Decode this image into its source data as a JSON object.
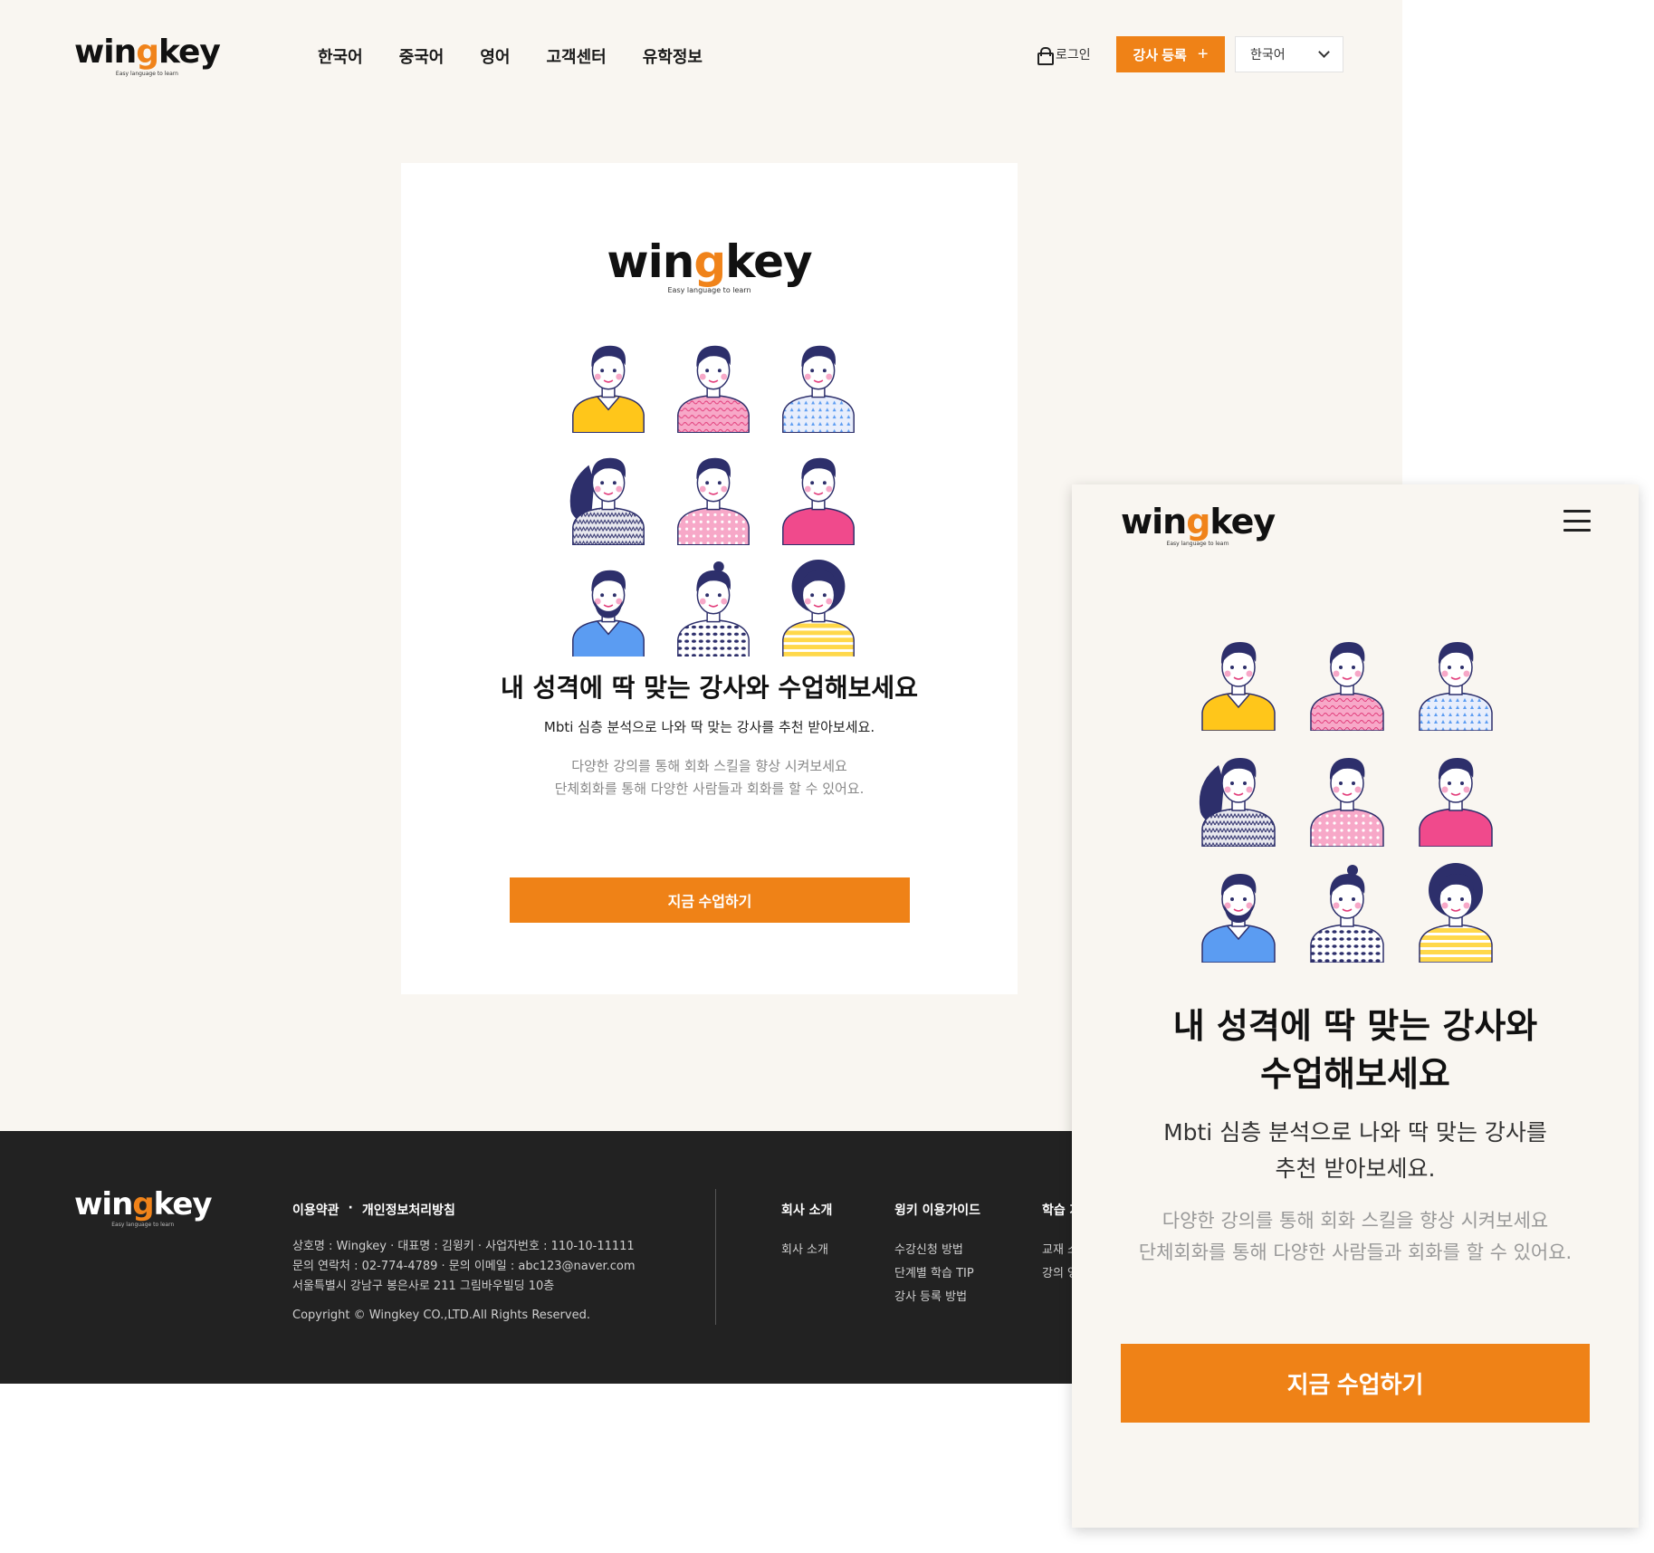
{
  "brand": {
    "word_prefix": "win",
    "word_g": "g",
    "word_suffix": "key",
    "tagline": "Easy language to learn",
    "accent": "#ef8217"
  },
  "header": {
    "nav": [
      "한국어",
      "중국어",
      "영어",
      "고객센터",
      "유학정보"
    ],
    "login_label": "로그인",
    "register_label": "강사 등록",
    "register_icon": "plus-icon",
    "language_selected": "한국어"
  },
  "card": {
    "title": "내 성격에 딱 맞는 강사와 수업해보세요",
    "subtitle": "Mbti 심층 분석으로 나와 딱 맞는 강사를 추천 받아보세요.",
    "desc_line1": "다양한 강의를 통해 회화 스킬을 향상 시켜보세요",
    "desc_line2": "단체회화를 통해 다양한 사람들과 회화를 할 수 있어요.",
    "cta": "지금 수업하기"
  },
  "avatars": [
    {
      "hair": "#2d2f6b",
      "shirt": "#ffc61a",
      "skin": "#ffffff",
      "pattern": "collar"
    },
    {
      "hair": "#2d2f6b",
      "shirt": "#f7a8c8",
      "skin": "#ffffff",
      "pattern": "waves"
    },
    {
      "hair": "#2d2f6b",
      "shirt": "#e8eefc",
      "skin": "#ffffff",
      "pattern": "triangles"
    },
    {
      "hair": "#2d2f6b",
      "shirt": "#e8e8ee",
      "skin": "#ffffff",
      "pattern": "zigzag"
    },
    {
      "hair": "#2d2f6b",
      "shirt": "#f7a8c8",
      "skin": "#ffffff",
      "pattern": "dots"
    },
    {
      "hair": "#2d2f6b",
      "shirt": "#f04a8c",
      "skin": "#ffffff",
      "pattern": "plain"
    },
    {
      "hair": "#2d2f6b",
      "shirt": "#5b9cf2",
      "skin": "#ffffff",
      "pattern": "collar"
    },
    {
      "hair": "#2d2f6b",
      "shirt": "#ffffff",
      "skin": "#ffffff",
      "pattern": "spots"
    },
    {
      "hair": "#2d2f6b",
      "shirt": "#ffd84a",
      "skin": "#ffffff",
      "pattern": "stripes"
    }
  ],
  "footer": {
    "terms": "이용약관",
    "separator": "·",
    "privacy": "개인정보처리방침",
    "info_line1": "상호명 : Wingkey · 대표명 : 김윙키 · 사업자번호 : 110-10-11111",
    "info_line2": "문의 연락처 : 02-774-4789 · 문의 이메일 : abc123@naver.com",
    "info_line3": "서울특별시 강남구 봉은사로 211 그림바우빌딩 10층",
    "copyright": "Copyright © Wingkey CO.,LTD.All Rights Reserved.",
    "columns": [
      {
        "title": "회사 소개",
        "links": [
          "회사 소개"
        ]
      },
      {
        "title": "윙키 이용가이드",
        "links": [
          "수강신청 방법",
          "단계별 학습 TIP",
          "강사 등록 방법"
        ]
      },
      {
        "title": "학습 자",
        "links": [
          "교재 소",
          "강의 영"
        ]
      }
    ]
  },
  "mobile": {
    "menu_icon": "hamburger-icon",
    "title_line1": "내 성격에 딱 맞는 강사와",
    "title_line2": "수업해보세요",
    "sub_line1": "Mbti 심층 분석으로 나와 딱 맞는 강사를",
    "sub_line2": "추천 받아보세요.",
    "desc_line1": "다양한 강의를 통해 회화 스킬을 향상 시켜보세요",
    "desc_line2": "단체회화를 통해 다양한 사람들과 회화를 할 수 있어요.",
    "cta": "지금 수업하기"
  }
}
